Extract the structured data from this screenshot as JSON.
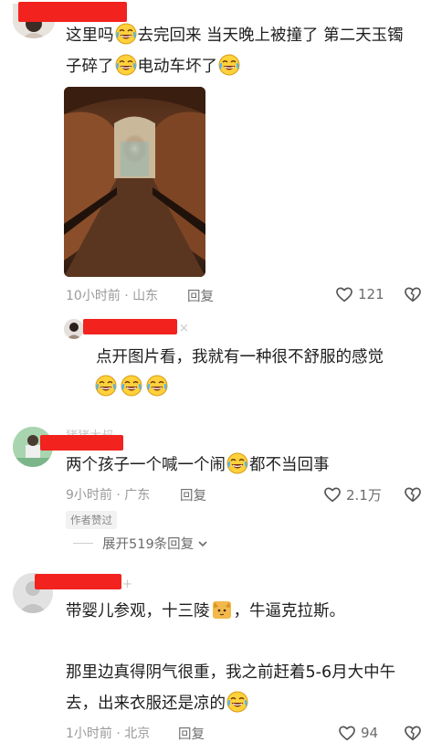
{
  "comments": [
    {
      "text_line1": "这里吗",
      "text_line1b": "去完回来 当天晚上被撞了 第二天玉镯",
      "text_line2a": "子碎了",
      "text_line2b": "电动车坏了",
      "time": "10小时前 · 山东",
      "reply_label": "回复",
      "likes": "121",
      "image_alt": "tunnel-photo"
    },
    {
      "name_ghost": "×",
      "text": "点开图片看，我就有一种很不舒服的感觉"
    },
    {
      "name_ghost": "猪猪大叔",
      "text_a": "两个孩子一个喊一个闹",
      "text_b": "都不当回事",
      "time": "9小时前 · 广东",
      "reply_label": "回复",
      "likes": "2.1万",
      "badge": "作者赞过",
      "expand": "展开519条回复"
    },
    {
      "name_ghost": "+",
      "text_a": "带婴儿参观，十三陵",
      "text_b": "，牛逼克拉斯。",
      "text_c": "那里边真得阴气很重，我之前赶着5-6月大中午",
      "text_d": "去，出来衣服还是凉的",
      "time": "1小时前 · 北京",
      "reply_label": "回复",
      "likes": "94"
    }
  ],
  "colors": {
    "redaction": "#f2221e",
    "meta": "#9a9a9a",
    "text": "#1e1e1e"
  }
}
